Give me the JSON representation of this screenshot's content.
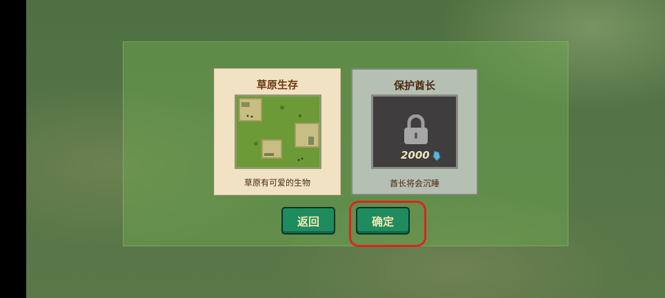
{
  "mode_select": {
    "cards": [
      {
        "title": "草原生存",
        "description": "草原有可爱的生物",
        "locked": false
      },
      {
        "title": "保护酋长",
        "description": "酋长将会沉睡",
        "locked": true,
        "unlock_cost": "2000",
        "cost_icon": "gem-icon"
      }
    ],
    "buttons": {
      "back": "返回",
      "confirm": "确定"
    }
  },
  "colors": {
    "button_bg": "#1e8c5e",
    "button_text": "#f5e7b0",
    "highlight": "#e0221c",
    "grass_card_bg": "#f1e2c3",
    "locked_card_bg": "#b6bfb3"
  }
}
